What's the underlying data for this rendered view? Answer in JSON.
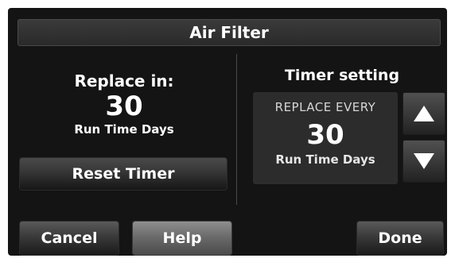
{
  "header": {
    "title": "Air Filter"
  },
  "replace": {
    "label": "Replace in:",
    "value": "30",
    "unit": "Run Time Days",
    "reset_label": "Reset Timer"
  },
  "timer": {
    "title": "Timer setting",
    "caption": "REPLACE EVERY",
    "value": "30",
    "unit": "Run Time Days",
    "up_icon": "triangle-up",
    "down_icon": "triangle-down"
  },
  "footer": {
    "cancel_label": "Cancel",
    "help_label": "Help",
    "done_label": "Done"
  }
}
